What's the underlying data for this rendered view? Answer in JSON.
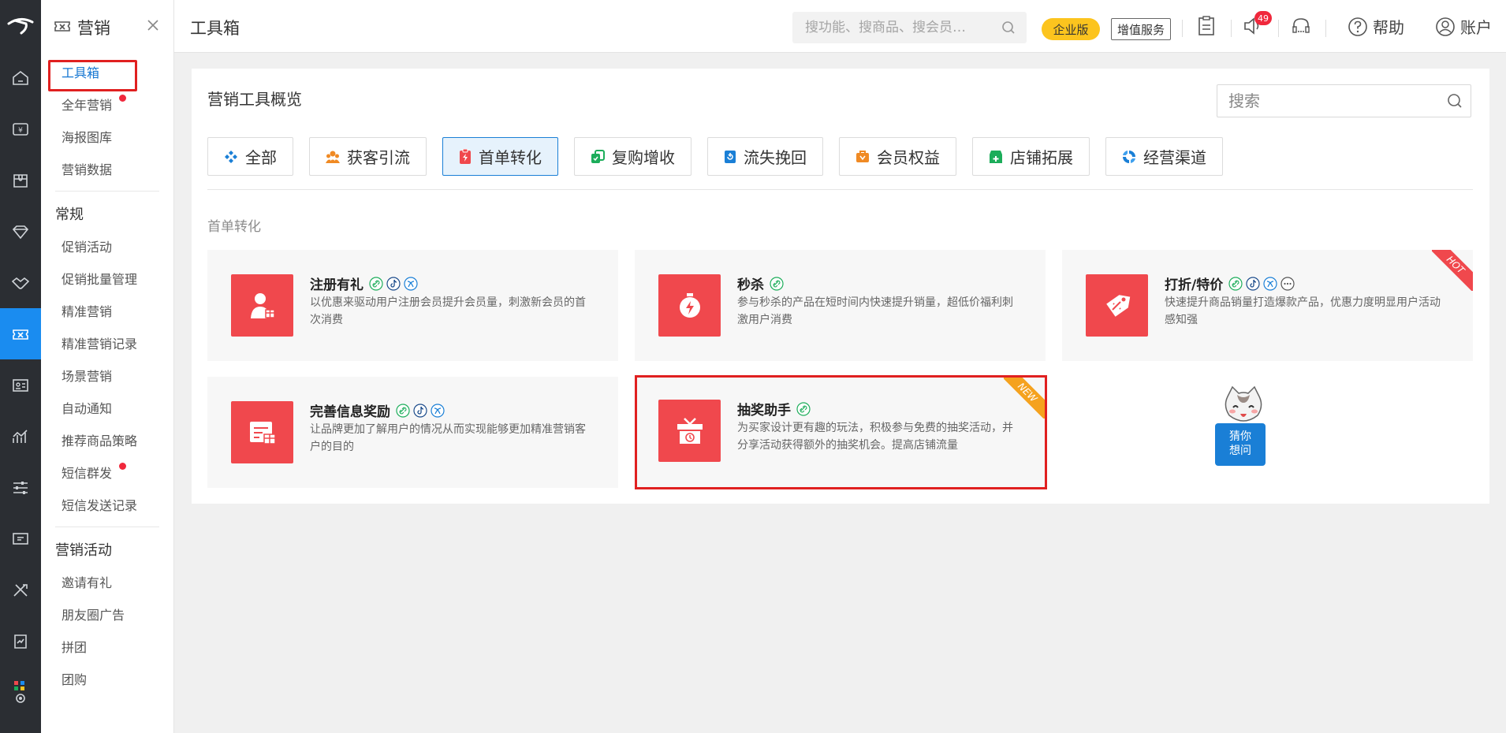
{
  "colors": {
    "accent": "#1a8cf0",
    "card_icon_bg": "#f0484d",
    "highlight": "#e02020",
    "enterprise_badge": "#fcc41e"
  },
  "rail": {
    "icons": [
      "logo-icon",
      "home-icon",
      "money-icon",
      "store-icon",
      "diamond-icon",
      "handshake-icon",
      "marketing-icon",
      "contact-card-icon",
      "analytics-icon",
      "sliders-icon",
      "coupon-icon",
      "tools-icon",
      "report-icon",
      "settings-icon"
    ]
  },
  "sidebar": {
    "title": "营销",
    "top_items": [
      {
        "label": "工具箱",
        "active": true
      },
      {
        "label": "全年营销",
        "dot": true
      },
      {
        "label": "海报图库"
      },
      {
        "label": "营销数据"
      }
    ],
    "groups": [
      {
        "title": "常规",
        "items": [
          "促销活动",
          "促销批量管理",
          "精准营销",
          "精准营销记录",
          "场景营销",
          "自动通知",
          "推荐商品策略",
          "短信群发",
          "短信发送记录"
        ]
      },
      {
        "title": "营销活动",
        "items": [
          "邀请有礼",
          "朋友圈广告",
          "拼团",
          "团购"
        ]
      }
    ]
  },
  "topbar": {
    "page_title": "工具箱",
    "search_placeholder": "搜功能、搜商品、搜会员…",
    "enterprise_badge": "企业版",
    "value_added": "增值服务",
    "notification_count": "49",
    "help": "帮助",
    "account": "账户"
  },
  "panel": {
    "title": "营销工具概览",
    "search_placeholder": "搜索",
    "categories": [
      {
        "label": "全部",
        "icon": "grid-diamond-icon",
        "color": "#1a7fd6"
      },
      {
        "label": "获客引流",
        "icon": "users-icon",
        "color": "#f08a24"
      },
      {
        "label": "首单转化",
        "icon": "clipboard-bolt-icon",
        "color": "#f0484d",
        "active": true
      },
      {
        "label": "复购增收",
        "icon": "repurchase-icon",
        "color": "#1cad5a"
      },
      {
        "label": "流失挽回",
        "icon": "recover-icon",
        "color": "#1a7fd6"
      },
      {
        "label": "会员权益",
        "icon": "member-bag-icon",
        "color": "#f08a24"
      },
      {
        "label": "店铺拓展",
        "icon": "shop-plus-icon",
        "color": "#1cad5a"
      },
      {
        "label": "经营渠道",
        "icon": "channel-icon",
        "color": "#1a7fd6"
      }
    ],
    "section_label": "首单转化",
    "cards": [
      {
        "title": "注册有礼",
        "desc": "以优惠来驱动用户注册会员提升会员量，刺激新会员的首次消费",
        "tags": [
          "link",
          "tiktok",
          "wechat"
        ],
        "icon": "register-gift-icon"
      },
      {
        "title": "秒杀",
        "desc": "参与秒杀的产品在短时间内快速提升销量，超低价福利刺激用户消费",
        "tags": [
          "link"
        ],
        "icon": "flash-sale-icon"
      },
      {
        "title": "打折/特价",
        "desc": "快速提升商品销量打造爆款产品，优惠力度明显用户活动感知强",
        "tags": [
          "link",
          "tiktok",
          "wechat",
          "more"
        ],
        "icon": "discount-tag-icon",
        "ribbon": "HOT"
      },
      {
        "title": "完善信息奖励",
        "desc": "让品牌更加了解用户的情况从而实现能够更加精准营销客户的目的",
        "tags": [
          "link",
          "tiktok",
          "wechat"
        ],
        "icon": "info-reward-icon"
      },
      {
        "title": "抽奖助手",
        "desc": "为买家设计更有趣的玩法，积极参与免费的抽奖活动，并分享活动获得额外的抽奖机会。提高店铺流量",
        "tags": [
          "link"
        ],
        "icon": "lottery-gift-icon",
        "ribbon": "NEW",
        "selected": true
      }
    ],
    "mascot_text": "猜你想问"
  }
}
